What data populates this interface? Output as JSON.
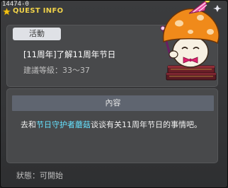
{
  "window": {
    "id_text": "14474-0",
    "title": "QUEST INFO",
    "colors": {
      "title": "#f0d24a",
      "highlight": "#66e2ff",
      "badge_bg": "#dfe1e6",
      "header_bg": "#5f6570"
    }
  },
  "quest": {
    "badge": "活動",
    "name": "[11周年]了解11周年节日",
    "level_label": "建議等級：33～37"
  },
  "content": {
    "header": "內容",
    "text_before": "去和",
    "npc_name": "节日守护者蘑菇",
    "text_after": "谈谈有关11周年节日的事情吧。"
  },
  "status": {
    "label": "狀態：可開始"
  },
  "icons": [
    "star-icon",
    "mushroom-mascot-illustration"
  ]
}
